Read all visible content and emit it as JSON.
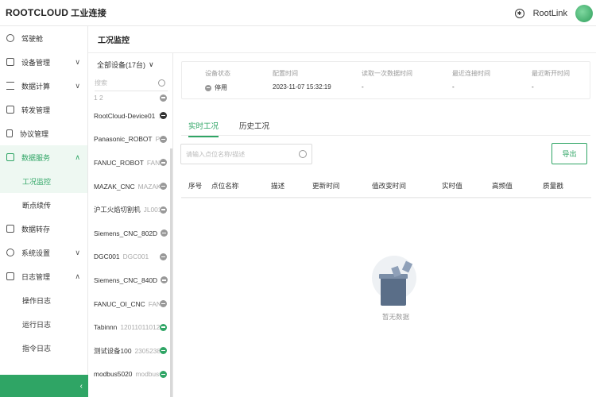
{
  "header": {
    "logo": "ROOTCLOUD",
    "logo_cn": "工业连接",
    "user": "RootLink",
    "colors": {
      "accent": "#2fa565"
    }
  },
  "sidebar": {
    "items": [
      {
        "label": "驾驶舱",
        "icon": "dashboard-icon",
        "chevron": ""
      },
      {
        "label": "设备管理",
        "icon": "device-icon",
        "chevron": "∨"
      },
      {
        "label": "数据计算",
        "icon": "compute-icon",
        "chevron": "∨"
      },
      {
        "label": "转发管理",
        "icon": "forward-icon",
        "chevron": ""
      },
      {
        "label": "协议管理",
        "icon": "protocol-icon",
        "chevron": ""
      },
      {
        "label": "数据服务",
        "icon": "data-service-icon",
        "chevron": "∧"
      },
      {
        "label": "工况监控",
        "sub": true,
        "active": true
      },
      {
        "label": "断点续传",
        "sub": true
      },
      {
        "label": "数据转存",
        "icon": "data-store-icon",
        "chevron": ""
      },
      {
        "label": "系统设置",
        "icon": "settings-icon",
        "chevron": "∨"
      },
      {
        "label": "日志管理",
        "icon": "log-icon",
        "chevron": "∧"
      },
      {
        "label": "操作日志",
        "sub": true
      },
      {
        "label": "运行日志",
        "sub": true
      },
      {
        "label": "指令日志",
        "sub": true
      }
    ],
    "collapse_glyph": "‹"
  },
  "page": {
    "title": "工况监控"
  },
  "devices": {
    "header": "全部设备(17台)",
    "search_placeholder": "搜索",
    "first_row": "1 2",
    "list": [
      {
        "name": "RootCloud-Device01",
        "id": "17...",
        "status": "dark"
      },
      {
        "name": "Panasonic_ROBOT",
        "id": "Pana...",
        "status": "offline"
      },
      {
        "name": "FANUC_ROBOT",
        "id": "FANUC_...",
        "status": "offline"
      },
      {
        "name": "MAZAK_CNC",
        "id": "MAZAK_C...",
        "status": "offline"
      },
      {
        "name": "沪工火焰切割机",
        "id": "JL001",
        "status": "offline"
      },
      {
        "name": "Siemens_CNC_802D",
        "id": "Sie...",
        "status": "offline"
      },
      {
        "name": "DGC001",
        "id": "DGC001",
        "status": "offline"
      },
      {
        "name": "Siemens_CNC_840D",
        "id": "Sie...",
        "status": "offline"
      },
      {
        "name": "FANUC_OI_CNC",
        "id": "FANUC...",
        "status": "offline"
      },
      {
        "name": "Tabinnn",
        "id": "120110110120",
        "status": "online"
      },
      {
        "name": "测试设备100",
        "id": "23052382...",
        "status": "online"
      },
      {
        "name": "modbus5020",
        "id": "modbus5...",
        "status": "online"
      }
    ]
  },
  "status": {
    "columns": [
      {
        "label": "设备状态",
        "value": "停用",
        "dot": true
      },
      {
        "label": "配置时间",
        "value": "2023-11-07 15:32:19"
      },
      {
        "label": "读取一次数据时间",
        "value": "-"
      },
      {
        "label": "最近连接时间",
        "value": "-"
      },
      {
        "label": "最近断开时间",
        "value": "-"
      }
    ]
  },
  "tabs": {
    "realtime": "实时工况",
    "history": "历史工况"
  },
  "point_search": {
    "placeholder": "请输入点位名称/描述"
  },
  "export_label": "导出",
  "table": {
    "headers": [
      "序号",
      "点位名称",
      "描述",
      "更新时间",
      "值改变时间",
      "实时值",
      "高频值",
      "质量戳"
    ]
  },
  "empty_text": "暂无数据"
}
